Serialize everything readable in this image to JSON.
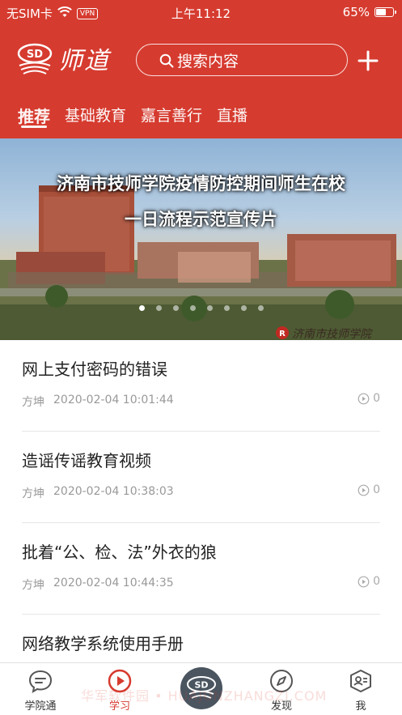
{
  "status_bar": {
    "carrier": "无SIM卡",
    "vpn": "VPN",
    "time": "上午11:12",
    "battery": "65%",
    "battery_level": 0.65
  },
  "header": {
    "logo_text": "师道",
    "logo_mark": "SD",
    "search_placeholder": "搜索内容"
  },
  "tabs": [
    {
      "label": "推荐",
      "active": true
    },
    {
      "label": "基础教育",
      "active": false
    },
    {
      "label": "嘉言善行",
      "active": false
    },
    {
      "label": "直播",
      "active": false
    }
  ],
  "banner": {
    "title_line1": "济南市技师学院疫情防控期间师生在校",
    "title_line2": "一日流程示范宣传片",
    "badge_text": "济南市技师学院",
    "slide_count": 8,
    "active_slide": 0
  },
  "articles": [
    {
      "title": "网上支付密码的错误",
      "author": "方坤",
      "time": "2020-02-04 10:01:44",
      "views": "0"
    },
    {
      "title": "造谣传谣教育视频",
      "author": "方坤",
      "time": "2020-02-04 10:38:03",
      "views": "0"
    },
    {
      "title": "批着“公、检、法”外衣的狼",
      "author": "方坤",
      "time": "2020-02-04 10:44:35",
      "views": "0"
    },
    {
      "title": "网络教学系统使用手册",
      "author": "",
      "time": "",
      "views": ""
    }
  ],
  "bottom_nav": [
    {
      "label": "学院通",
      "icon": "chat-bubble-icon",
      "active": false
    },
    {
      "label": "学习",
      "icon": "play-circle-icon",
      "active": true
    },
    {
      "label": "",
      "icon": "sd-logo-icon",
      "active": false
    },
    {
      "label": "发现",
      "icon": "compass-icon",
      "active": false
    },
    {
      "label": "我",
      "icon": "profile-card-icon",
      "active": false
    }
  ],
  "watermark": "华军软件园 • HUAJUNZHANGZI.COM",
  "colors": {
    "brand_red": "#d63b2f",
    "text_dark": "#222222",
    "text_muted": "#999999"
  }
}
